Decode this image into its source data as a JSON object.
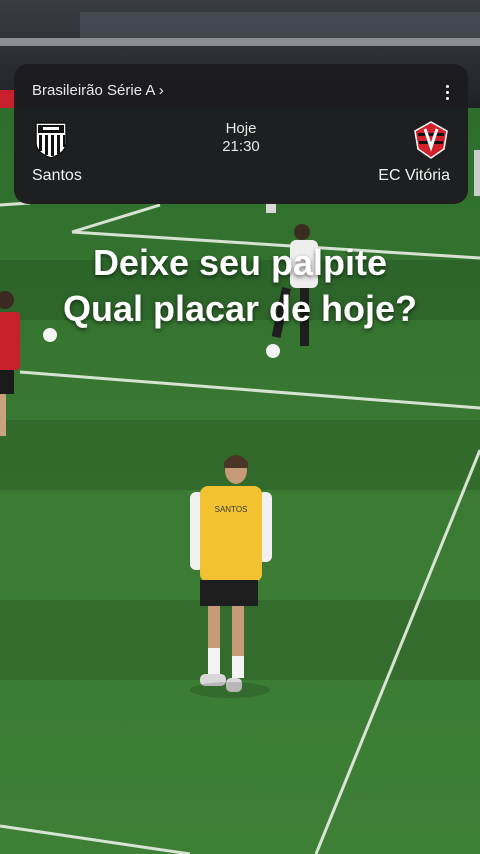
{
  "match_card": {
    "competition": "Brasileirão Série A ›",
    "day": "Hoje",
    "time": "21:30",
    "home_team": "Santos",
    "away_team": "EC Vitória",
    "menu_icon": "more-vert-icon"
  },
  "overlay": {
    "line1": "Deixe seu palpite",
    "line2": "Qual placar de hoje?"
  },
  "photo": {
    "subject": "football-warmup-scene",
    "bib_text": "SANTOS",
    "pitch_color": "#3a7a33",
    "bib_color": "#f2c230"
  }
}
